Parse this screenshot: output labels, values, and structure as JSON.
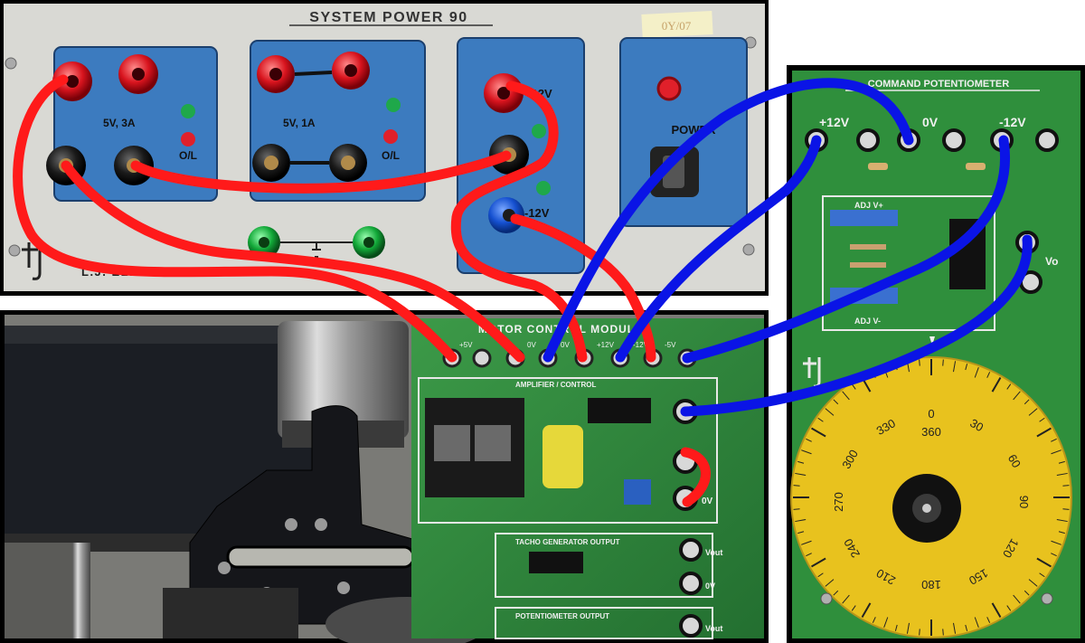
{
  "power_supply": {
    "title": "SYSTEM POWER 90",
    "sticker": "0Y/07",
    "label_5v_3a": "5V, 3A",
    "label_5v_1a": "5V, 1A",
    "label_ol_1": "O/L",
    "label_ol_2": "O/L",
    "label_plus_12v": "+12V",
    "label_minus_12v": "-12V",
    "label_power": "POWER",
    "brand": "L.J. ELECTRONICS"
  },
  "motor_board": {
    "title": "MOTOR CONTROL MODULE",
    "terminal_labels": [
      "+5V",
      "0V",
      "0V",
      "+12V",
      "-12V",
      "-5V"
    ],
    "section_amplifier": "AMPLIFIER / CONTROL",
    "section_tacho": "TACHO GENERATOR OUTPUT",
    "section_pot": "POTENTIOMETER OUTPUT",
    "jack_0v_1": "0V",
    "jack_vout_1": "Vout",
    "jack_0v_2": "0V",
    "jack_vout_2": "Vout"
  },
  "command_pot": {
    "title": "COMMAND POTENTIOMETER",
    "label_plus_12v": "+12V",
    "label_0v": "0V",
    "label_minus_12v": "-12V",
    "label_adj_v_plus": "ADJ V+",
    "label_adj_v_minus": "ADJ V-",
    "label_vo": "Vo",
    "dial_labels": [
      "0",
      "30",
      "60",
      "90",
      "120",
      "150",
      "180",
      "210",
      "240",
      "270",
      "300",
      "330"
    ],
    "dial_center": "360"
  },
  "colors": {
    "wire_red": "#ff1a1a",
    "wire_blue": "#0a14e6",
    "panel_grey": "#d9d9d4",
    "module_blue": "#3c7bbf",
    "pcb_green": "#2d8a3a",
    "dial_yellow": "#e8c21e"
  },
  "icons": [
    "lj-logo-icon"
  ]
}
